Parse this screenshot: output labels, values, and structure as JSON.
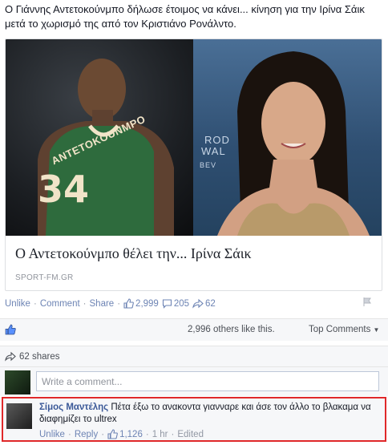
{
  "post": {
    "text": "Ο Γιάννης Αντετοκούνμπο δήλωσε έτοιμος να κάνει... κίνηση για την Ιρίνα Σάικ μετά το χωρισμό της από τον Κριστιάνο Ρονάλντο."
  },
  "link_card": {
    "title": "Ο Αντετοκούνμπο θέλει την... Ιρίνα Σάικ",
    "domain": "SPORT-FM.GR",
    "jersey_name": "ANTETOKOUNMPO",
    "jersey_number": "34",
    "backdrop_text_1": "ROD",
    "backdrop_text_2": "WAL",
    "backdrop_text_3": "BEV"
  },
  "actions": {
    "unlike": "Unlike",
    "comment": "Comment",
    "share": "Share",
    "sep": "·",
    "likes": "2,999",
    "comments": "205",
    "shares": "62"
  },
  "likes_bar": {
    "count_text": "2,996 others like this.",
    "top_comments": "Top Comments"
  },
  "shares_bar": {
    "text": "62 shares"
  },
  "composer": {
    "placeholder": "Write a comment..."
  },
  "comment": {
    "author": "Σίμος Μαντέλης",
    "text": "Πέτα έξω το ανακοντα γιανναρε και άσε τον άλλο το βλακαμα να διαφημίζει το ultrex",
    "unlike": "Unlike",
    "reply": "Reply",
    "likes": "1,126",
    "time": "1 hr",
    "edited": "Edited"
  },
  "colors": {
    "link": "#6d84b4",
    "author": "#3b5998",
    "highlight_border": "#e0282a",
    "jersey_green": "#2e6b3d"
  }
}
